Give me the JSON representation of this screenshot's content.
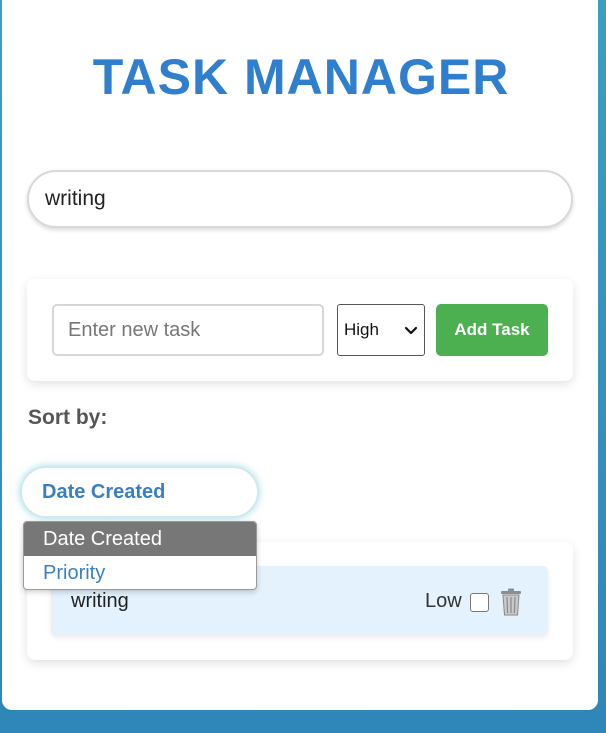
{
  "app": {
    "title": "TASK MANAGER"
  },
  "search": {
    "value": "writing"
  },
  "add_task": {
    "placeholder": "Enter new task",
    "priority_selected": "High",
    "button_label": "Add Task"
  },
  "sort": {
    "label": "Sort by:",
    "selected": "Date Created",
    "options": [
      "Date Created",
      "Priority"
    ]
  },
  "tasks": [
    {
      "text": "writing",
      "priority": "Low",
      "completed": false
    }
  ],
  "colors": {
    "accent": "#2f7fce",
    "add_button": "#4caf50",
    "task_bg": "#e3f2fd",
    "background_top": "#39a0c2",
    "background_bottom": "#2f86b8"
  },
  "icons": {
    "priority_dropdown": "chevron-down-icon",
    "delete": "trash-icon"
  }
}
